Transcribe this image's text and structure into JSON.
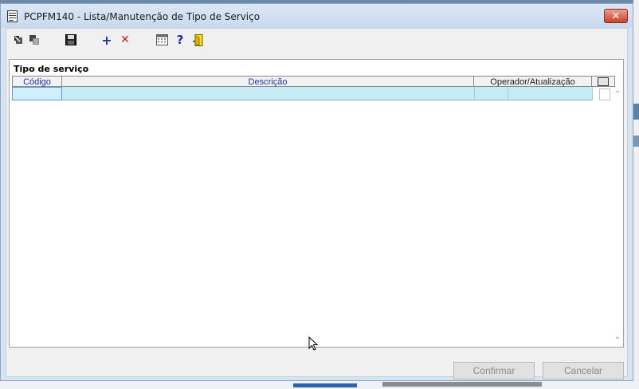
{
  "window": {
    "title": "PCPFM140 - Lista/Manutenção de Tipo de Serviço",
    "close_label": "✕"
  },
  "toolbar": {
    "items": [
      {
        "name": "import-icon"
      },
      {
        "name": "copy-icon"
      },
      {
        "name": "save-icon"
      },
      {
        "name": "add-icon",
        "glyph": "+"
      },
      {
        "name": "delete-icon",
        "glyph": "✕"
      },
      {
        "name": "calculator-icon"
      },
      {
        "name": "help-icon",
        "glyph": "?"
      },
      {
        "name": "exit-icon"
      }
    ]
  },
  "panel": {
    "title": "Tipo de serviço",
    "columns": [
      {
        "label": "Código"
      },
      {
        "label": "Descrição"
      },
      {
        "label": "Operador/Atualização"
      }
    ]
  },
  "buttons": {
    "confirm": "Confirmar",
    "cancel": "Cancelar"
  },
  "colors": {
    "row_selected": "#c5ebf6",
    "header_text": "#1a33a8",
    "add": "#1b2fb5",
    "delete": "#d01818"
  }
}
